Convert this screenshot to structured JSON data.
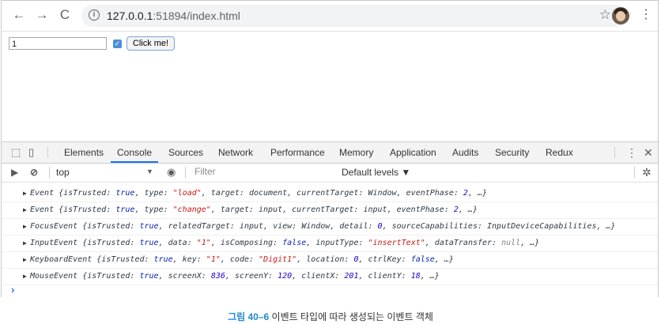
{
  "browser": {
    "url_host": "127.0.0.1",
    "url_rest": ":51894/index.html"
  },
  "page": {
    "input_value": "1",
    "checkbox_checked": true,
    "button_label": "Click me!"
  },
  "devtools": {
    "tabs": [
      "Elements",
      "Console",
      "Sources",
      "Network",
      "Performance",
      "Memory",
      "Application",
      "Audits",
      "Security",
      "Redux"
    ],
    "active_tab": "Console",
    "context": "top",
    "filter_placeholder": "Filter",
    "levels": "Default levels ▼",
    "logs": [
      "Event {isTrusted: true, type: \"load\", target: document, currentTarget: Window, eventPhase: 2, …}",
      "Event {isTrusted: true, type: \"change\", target: input, currentTarget: input, eventPhase: 2, …}",
      "FocusEvent {isTrusted: true, relatedTarget: input, view: Window, detail: 0, sourceCapabilities: InputDeviceCapabilities, …}",
      "InputEvent {isTrusted: true, data: \"1\", isComposing: false, inputType: \"insertText\", dataTransfer: null, …}",
      "KeyboardEvent {isTrusted: true, key: \"1\", code: \"Digit1\", location: 0, ctrlKey: false, …}",
      "MouseEvent {isTrusted: true, screenX: 836, screenY: 120, clientX: 201, clientY: 18, …}"
    ]
  },
  "caption": {
    "figure": "그림 40–6",
    "text": " 이벤트 타입에 따라 생성되는 이벤트 객체"
  },
  "colors": {
    "accent": "#1a73e8",
    "string": "#c41a16",
    "number": "#1c00cf",
    "keyword": "#0d22aa",
    "caption_figure": "#1f8ad1"
  }
}
